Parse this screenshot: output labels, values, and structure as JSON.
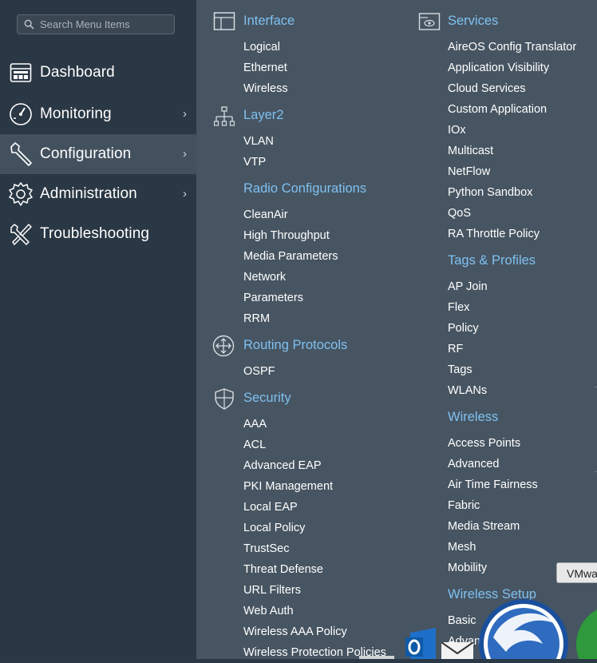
{
  "search": {
    "placeholder": "Search Menu Items"
  },
  "sidebar": {
    "items": [
      {
        "label": "Dashboard",
        "icon": "dashboard-icon",
        "has_submenu": false
      },
      {
        "label": "Monitoring",
        "icon": "gauge-icon",
        "has_submenu": true
      },
      {
        "label": "Configuration",
        "icon": "wrench-icon",
        "has_submenu": true,
        "active": true
      },
      {
        "label": "Administration",
        "icon": "gear-icon",
        "has_submenu": true
      },
      {
        "label": "Troubleshooting",
        "icon": "tools-icon",
        "has_submenu": false
      }
    ],
    "chevron": "›"
  },
  "menu": {
    "left": {
      "interface": {
        "title": "Interface",
        "items": [
          "Logical",
          "Ethernet",
          "Wireless"
        ]
      },
      "layer2": {
        "title": "Layer2",
        "items": [
          "VLAN",
          "VTP"
        ]
      },
      "radio": {
        "title": "Radio Configurations",
        "items": [
          "CleanAir",
          "High Throughput",
          "Media Parameters",
          "Network",
          "Parameters",
          "RRM"
        ]
      },
      "routing": {
        "title": "Routing Protocols",
        "items": [
          "OSPF"
        ]
      },
      "security": {
        "title": "Security",
        "items": [
          "AAA",
          "ACL",
          "Advanced EAP",
          "PKI Management",
          "Local EAP",
          "Local Policy",
          "TrustSec",
          "Threat Defense",
          "URL Filters",
          "Web Auth",
          "Wireless AAA Policy",
          "Wireless Protection Policies"
        ]
      }
    },
    "right": {
      "services": {
        "title": "Services",
        "items": [
          "AireOS Config Translator",
          "Application Visibility",
          "Cloud Services",
          "Custom Application",
          "IOx",
          "Multicast",
          "NetFlow",
          "Python Sandbox",
          "QoS",
          "RA Throttle Policy"
        ]
      },
      "tags": {
        "title": "Tags & Profiles",
        "items": [
          "AP Join",
          "Flex",
          "Policy",
          "RF",
          "Tags",
          "WLANs"
        ]
      },
      "wireless": {
        "title": "Wireless",
        "items": [
          "Access Points",
          "Advanced",
          "Air Time Fairness",
          "Fabric",
          "Media Stream",
          "Mesh",
          "Mobility"
        ]
      },
      "wireless_setup": {
        "title": "Wireless Setup",
        "items": [
          "Basic",
          "Advan"
        ]
      }
    }
  },
  "tooltip": {
    "text": "VMwa"
  },
  "colors": {
    "sidebar_bg": "#2a3744",
    "panel_bg": "#475562",
    "accent": "#7fc0f0",
    "active_bg": "#43515f"
  }
}
